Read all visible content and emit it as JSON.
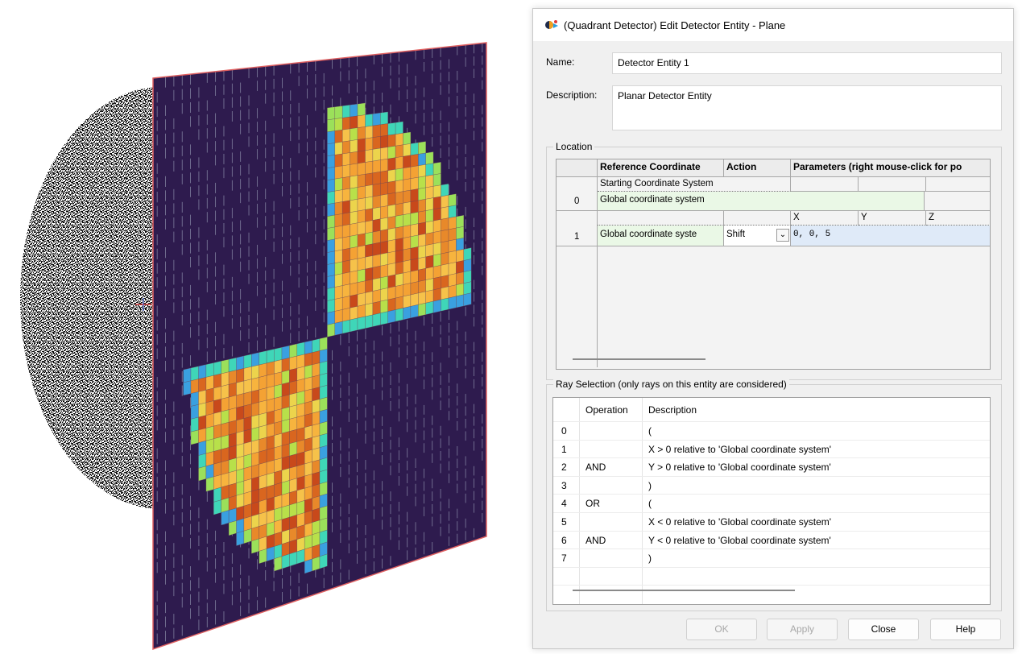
{
  "dialog": {
    "title": "(Quadrant Detector) Edit Detector Entity - Plane",
    "name_label": "Name:",
    "name_value": "Detector Entity 1",
    "description_label": "Description:",
    "description_value": "Planar Detector Entity"
  },
  "location": {
    "group_label": "Location",
    "headers": {
      "ref": "Reference Coordinate",
      "action": "Action",
      "params": "Parameters (right mouse-click for po"
    },
    "row0": {
      "number": "0",
      "sublabel": "Starting Coordinate System",
      "value": "Global coordinate system"
    },
    "row1": {
      "number": "1",
      "x_label": "X",
      "y_label": "Y",
      "z_label": "Z",
      "ref": "Global coordinate syste",
      "action": "Shift",
      "params": "0,  0,  5"
    }
  },
  "ray_selection": {
    "group_label": "Ray Selection (only rays on this entity are considered)",
    "headers": {
      "operation": "Operation",
      "description": "Description"
    },
    "rows": [
      {
        "n": "0",
        "op": "",
        "desc": "("
      },
      {
        "n": "1",
        "op": "",
        "desc": "X > 0 relative to 'Global coordinate system'"
      },
      {
        "n": "2",
        "op": "AND",
        "desc": "Y > 0 relative to 'Global coordinate system'"
      },
      {
        "n": "3",
        "op": "",
        "desc": ")"
      },
      {
        "n": "4",
        "op": "OR",
        "desc": "("
      },
      {
        "n": "5",
        "op": "",
        "desc": "X < 0 relative to 'Global coordinate system'"
      },
      {
        "n": "6",
        "op": "AND",
        "desc": "Y < 0 relative to 'Global coordinate system'"
      },
      {
        "n": "7",
        "op": "",
        "desc": ")"
      }
    ]
  },
  "buttons": {
    "ok": "OK",
    "apply": "Apply",
    "close": "Close",
    "help": "Help"
  },
  "viewport": {
    "plane_color": "#2e1b4e",
    "border_color": "#e06060",
    "heatmap_colors": [
      "#f4a234",
      "#e8892a",
      "#f6c24a",
      "#d9661f",
      "#f7b43e",
      "#c8491b",
      "#ecd44c",
      "#b8e04a"
    ],
    "edge_colors": [
      "#3fd6b8",
      "#3aa0e0",
      "#9be05a"
    ]
  },
  "icons": {
    "title": "detector-entity-icon",
    "dropdown": "chevron-down-icon"
  }
}
